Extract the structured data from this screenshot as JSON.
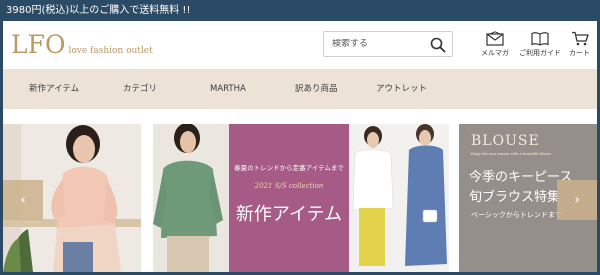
{
  "topbar": {
    "notice": "3980円(税込)以上のご購入で送料無料 !!"
  },
  "header": {
    "logo": "LFO",
    "logo_sub": "love fashion outlet",
    "search_placeholder": "検索する",
    "icons": [
      {
        "name": "mail-icon",
        "label": "メルマガ"
      },
      {
        "name": "guide-icon",
        "label": "ご利用ガイド"
      },
      {
        "name": "cart-icon",
        "label": "カート"
      }
    ]
  },
  "nav": {
    "items": [
      "新作アイテム",
      "カテゴリ",
      "MARTHA",
      "訳あり商品",
      "アウトレット"
    ]
  },
  "banner": {
    "center_top": "春夏のトレンドから定番アイテムまで",
    "center_collection": "2021 S/S collection",
    "center_title": "新作アイテム",
    "right_blouse": "BLOUSE",
    "right_sub": "Enjoy the new season with a beautiful blouse",
    "right_title_1": "今季のキーピース",
    "right_title_2": "旬ブラウス特集",
    "right_caption": "ベーシックからトレンドまで",
    "arrow_prev": "‹",
    "arrow_next": "›"
  },
  "colors": {
    "topbar": "#2b4a66",
    "nav_bg": "#ece2d6",
    "logo": "#b99a63",
    "center_bg": "#a65a86"
  }
}
